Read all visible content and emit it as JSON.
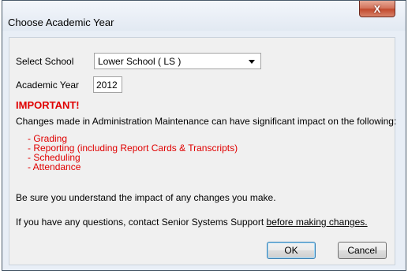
{
  "window": {
    "title": "Choose Academic Year",
    "close_glyph": "X"
  },
  "form": {
    "school_label": "Select School",
    "school_value": "Lower School ( LS )",
    "year_label": "Academic Year",
    "year_value": "2012"
  },
  "notice": {
    "heading": "IMPORTANT!",
    "intro": "Changes made in Administration Maintenance can have significant impact on the following:",
    "items": [
      "- Grading",
      "- Reporting (including Report Cards & Transcripts)",
      "- Scheduling",
      "- Attendance"
    ],
    "understand": "Be sure you understand the impact of any changes you make.",
    "contact_prefix": "If you have any questions, contact Senior Systems Support ",
    "contact_link": "before making changes."
  },
  "buttons": {
    "ok": "OK",
    "cancel": "Cancel"
  }
}
